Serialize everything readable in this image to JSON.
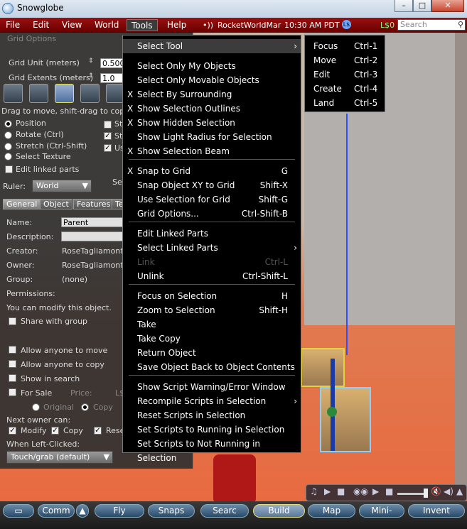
{
  "window": {
    "title": "Snowglobe"
  },
  "menubar": {
    "items": [
      "File",
      "Edit",
      "View",
      "World",
      "Tools",
      "Help"
    ],
    "region": "RocketWorldMar",
    "time": "10:30 AM PDT",
    "balance": "L$0",
    "search_placeholder": "Search"
  },
  "build": {
    "grid_options": "Grid Options",
    "grid_unit_label": "Grid Unit (meters)",
    "grid_unit_value": "0.500",
    "grid_extents_label": "Grid Extents (meters)",
    "grid_extents_value": "1.0",
    "hint": "Drag to move, shift-drag to copy",
    "radios": [
      "Position",
      "Rotate (Ctrl)",
      "Stretch (Ctrl-Shift)",
      "Select Texture"
    ],
    "right_checks": [
      "Str",
      "Str",
      "Us"
    ],
    "edit_linked": "Edit linked parts",
    "ruler_label": "Ruler:",
    "ruler_value": "World",
    "sel_label": "Sel",
    "tabs": [
      "General",
      "Object",
      "Features",
      "Tex"
    ],
    "name_label": "Name:",
    "name_value": "Parent",
    "desc_label": "Description:",
    "creator_label": "Creator:",
    "creator_value": "RoseTagliamonte",
    "owner_label": "Owner:",
    "owner_value": "RoseTagliamonte",
    "group_label": "Group:",
    "group_value": "(none)",
    "permissions_label": "Permissions:",
    "modify_msg": "You can modify this object.",
    "share_group": "Share with group",
    "allow_move": "Allow anyone to move",
    "allow_copy": "Allow anyone to copy",
    "show_search": "Show in search",
    "for_sale": "For Sale",
    "price_label": "Price:",
    "price_currency": "L$",
    "original": "Original",
    "copy": "Copy",
    "next_owner": "Next owner can:",
    "next_modify": "Modify",
    "next_copy": "Copy",
    "next_resell": "Rese",
    "left_click_label": "When Left-Clicked:",
    "left_click_value": "Touch/grab (default)"
  },
  "tools_menu": {
    "items": [
      {
        "label": "Select Tool",
        "shortcut": "",
        "check": "",
        "submenu": "›"
      },
      {
        "label": "Select Only My Objects",
        "shortcut": "",
        "check": ""
      },
      {
        "label": "Select Only Movable Objects",
        "shortcut": "",
        "check": ""
      },
      {
        "label": "Select By Surrounding",
        "shortcut": "",
        "check": "X"
      },
      {
        "label": "Show Selection Outlines",
        "shortcut": "",
        "check": "X"
      },
      {
        "label": "Show Hidden Selection",
        "shortcut": "",
        "check": "X"
      },
      {
        "label": "Show Light Radius for Selection",
        "shortcut": "",
        "check": ""
      },
      {
        "label": "Show Selection Beam",
        "shortcut": "",
        "check": "X"
      },
      {
        "label": "Snap to Grid",
        "shortcut": "G",
        "check": "X"
      },
      {
        "label": "Snap Object XY to Grid",
        "shortcut": "Shift-X",
        "check": ""
      },
      {
        "label": "Use Selection for Grid",
        "shortcut": "Shift-G",
        "check": ""
      },
      {
        "label": "Grid Options...",
        "shortcut": "Ctrl-Shift-B",
        "check": ""
      },
      {
        "label": "Edit Linked Parts",
        "shortcut": "",
        "check": ""
      },
      {
        "label": "Select Linked Parts",
        "shortcut": "",
        "check": "",
        "submenu": "›"
      },
      {
        "label": "Link",
        "shortcut": "Ctrl-L",
        "check": "",
        "disabled": true
      },
      {
        "label": "Unlink",
        "shortcut": "Ctrl-Shift-L",
        "check": ""
      },
      {
        "label": "Focus on Selection",
        "shortcut": "H",
        "check": ""
      },
      {
        "label": "Zoom to Selection",
        "shortcut": "Shift-H",
        "check": ""
      },
      {
        "label": "Take",
        "shortcut": "",
        "check": ""
      },
      {
        "label": "Take Copy",
        "shortcut": "",
        "check": ""
      },
      {
        "label": "Return Object",
        "shortcut": "",
        "check": ""
      },
      {
        "label": "Save Object Back to Object Contents",
        "shortcut": "",
        "check": ""
      },
      {
        "label": "Show Script Warning/Error Window",
        "shortcut": "",
        "check": ""
      },
      {
        "label": "Recompile Scripts in Selection",
        "shortcut": "",
        "check": "",
        "submenu": "›"
      },
      {
        "label": "Reset Scripts in Selection",
        "shortcut": "",
        "check": ""
      },
      {
        "label": "Set Scripts to Running in Selection",
        "shortcut": "",
        "check": ""
      },
      {
        "label": "Set Scripts to Not Running in Selection",
        "shortcut": "",
        "check": ""
      }
    ]
  },
  "select_tool_submenu": {
    "items": [
      {
        "label": "Focus",
        "shortcut": "Ctrl-1"
      },
      {
        "label": "Move",
        "shortcut": "Ctrl-2"
      },
      {
        "label": "Edit",
        "shortcut": "Ctrl-3"
      },
      {
        "label": "Create",
        "shortcut": "Ctrl-4"
      },
      {
        "label": "Land",
        "shortcut": "Ctrl-5"
      }
    ]
  },
  "bottom_bar": {
    "buttons": [
      "Comm",
      "Fly",
      "Snaps",
      "Searc",
      "Build",
      "Map",
      "Mini-",
      "Invent"
    ]
  }
}
